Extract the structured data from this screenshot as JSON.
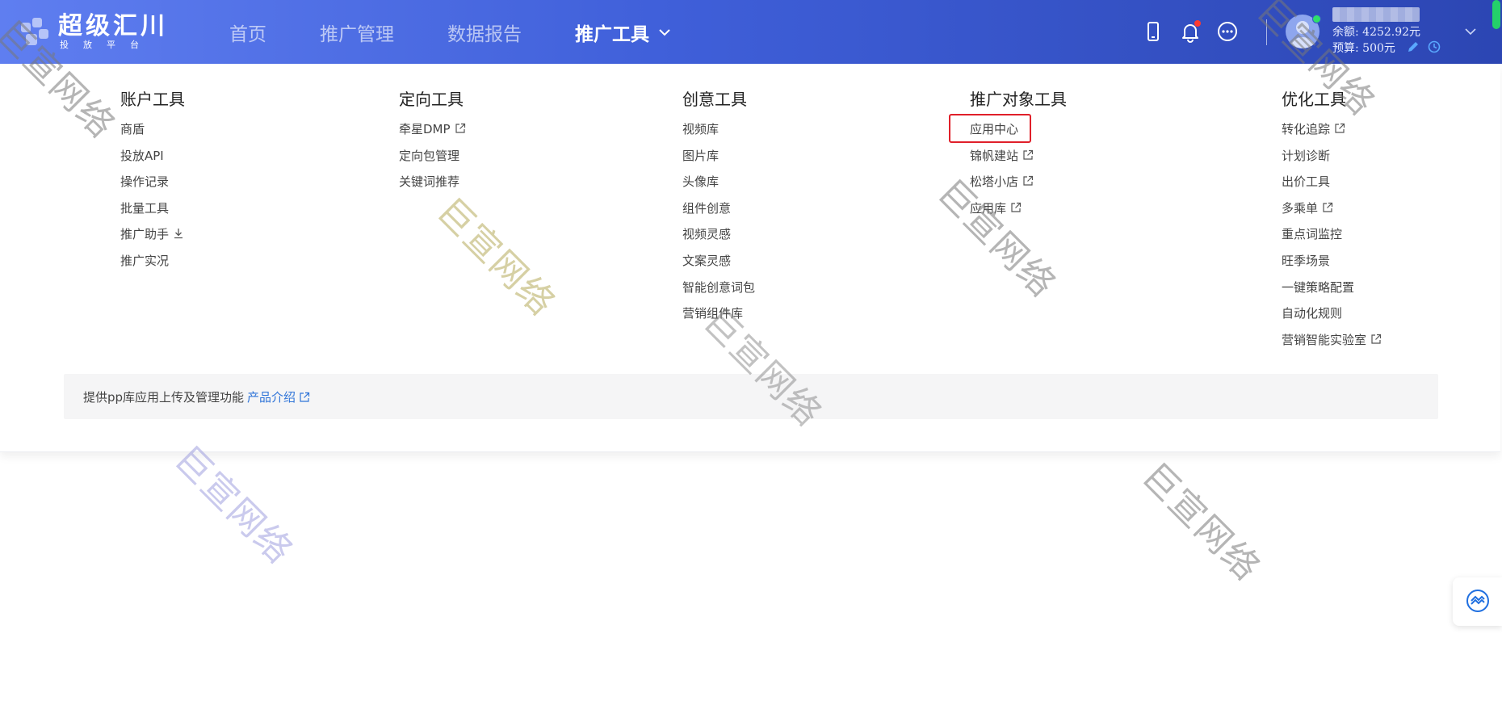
{
  "logo": {
    "title": "超级汇川",
    "subtitle": "投放平台"
  },
  "nav": {
    "items": [
      {
        "label": "首页",
        "active": false
      },
      {
        "label": "推广管理",
        "active": false
      },
      {
        "label": "数据报告",
        "active": false
      },
      {
        "label": "推广工具",
        "active": true
      }
    ]
  },
  "header_icons": [
    "mobile-icon",
    "bell-icon",
    "more-icon"
  ],
  "account": {
    "name": "██████",
    "balance": "余额: 4252.92元",
    "budget": "预算: 500元"
  },
  "menu": {
    "columns": [
      {
        "title": "账户工具",
        "items": [
          {
            "label": "商盾",
            "icon": ""
          },
          {
            "label": "投放API",
            "icon": ""
          },
          {
            "label": "操作记录",
            "icon": ""
          },
          {
            "label": "批量工具",
            "icon": ""
          },
          {
            "label": "推广助手",
            "icon": "download-icon"
          },
          {
            "label": "推广实况",
            "icon": ""
          }
        ]
      },
      {
        "title": "定向工具",
        "items": [
          {
            "label": "牵星DMP",
            "icon": "external-link-icon"
          },
          {
            "label": "定向包管理",
            "icon": ""
          },
          {
            "label": "关键词推荐",
            "icon": ""
          }
        ]
      },
      {
        "title": "创意工具",
        "items": [
          {
            "label": "视频库",
            "icon": ""
          },
          {
            "label": "图片库",
            "icon": ""
          },
          {
            "label": "头像库",
            "icon": ""
          },
          {
            "label": "组件创意",
            "icon": ""
          },
          {
            "label": "视频灵感",
            "icon": ""
          },
          {
            "label": "文案灵感",
            "icon": ""
          },
          {
            "label": "智能创意词包",
            "icon": ""
          },
          {
            "label": "营销组件库",
            "icon": ""
          }
        ]
      },
      {
        "title": "推广对象工具",
        "items": [
          {
            "label": "应用中心",
            "icon": "",
            "highlighted": true
          },
          {
            "label": "锦帆建站",
            "icon": "external-link-icon"
          },
          {
            "label": "松塔小店",
            "icon": "external-link-icon"
          },
          {
            "label": "应用库",
            "icon": "external-link-icon"
          }
        ]
      },
      {
        "title": "优化工具",
        "items": [
          {
            "label": "转化追踪",
            "icon": "external-link-icon"
          },
          {
            "label": "计划诊断",
            "icon": ""
          },
          {
            "label": "出价工具",
            "icon": ""
          },
          {
            "label": "多乘单",
            "icon": "external-link-icon"
          },
          {
            "label": "重点词监控",
            "icon": ""
          },
          {
            "label": "旺季场景",
            "icon": ""
          },
          {
            "label": "一键策略配置",
            "icon": ""
          },
          {
            "label": "自动化规则",
            "icon": ""
          },
          {
            "label": "营销智能实验室",
            "icon": "external-link-icon"
          }
        ]
      }
    ],
    "info": {
      "text": "提供pp库应用上传及管理功能",
      "link": "产品介绍"
    }
  },
  "watermark": {
    "text": "巨宣网络"
  },
  "colors": {
    "header_start": "#5f7ef0",
    "header_end": "#2c46b3",
    "highlight": "#e0202a",
    "link": "#2f74d8"
  }
}
